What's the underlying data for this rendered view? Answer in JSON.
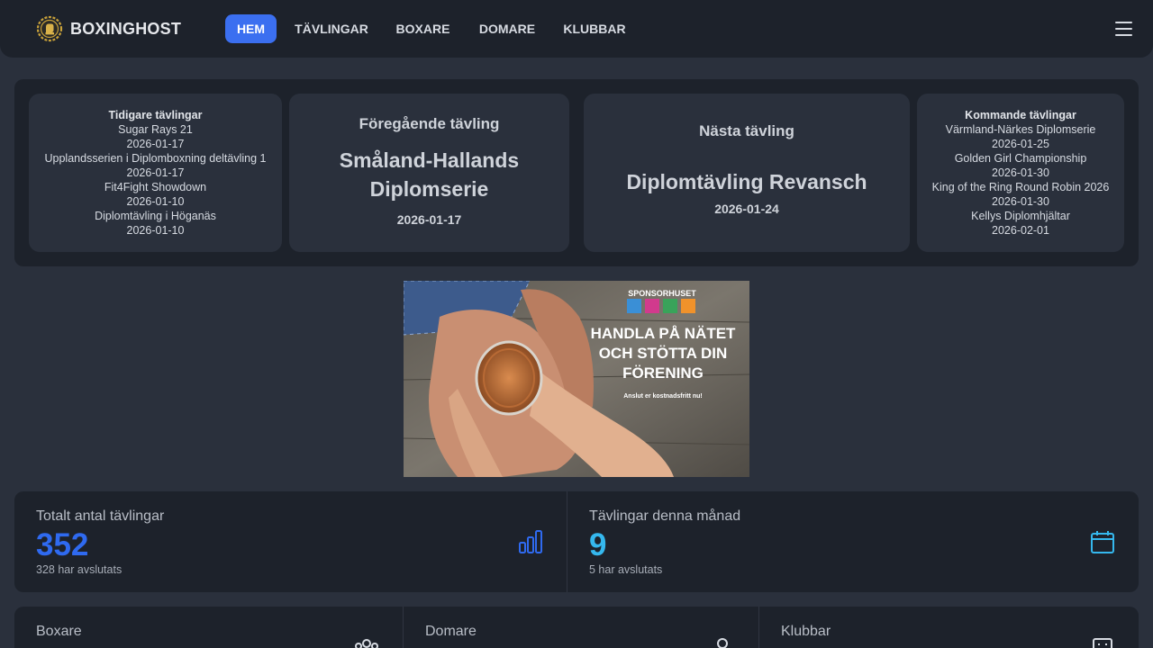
{
  "brand": {
    "name": "BOXINGHOST",
    "logo_icon": "boxing-crest-icon"
  },
  "nav": {
    "items": [
      {
        "label": "HEM",
        "active": true
      },
      {
        "label": "TÄVLINGAR",
        "active": false
      },
      {
        "label": "BOXARE",
        "active": false
      },
      {
        "label": "DOMARE",
        "active": false
      },
      {
        "label": "KLUBBAR",
        "active": false
      }
    ],
    "menu_icon": "hamburger-menu-icon"
  },
  "previous_competitions": {
    "title": "Tidigare tävlingar",
    "items": [
      {
        "name": "Sugar Rays 21",
        "date": "2026-01-17"
      },
      {
        "name": "Upplandsserien i Diplomboxning deltävling 1",
        "date": "2026-01-17"
      },
      {
        "name": "Fit4Fight Showdown",
        "date": "2026-01-10"
      },
      {
        "name": "Diplomtävling i Höganäs",
        "date": "2026-01-10"
      }
    ]
  },
  "last_competition": {
    "heading": "Föregående tävling",
    "name_line1": "Småland-Hallands",
    "name_line2": "Diplomserie",
    "date": "2026-01-17"
  },
  "next_competition": {
    "heading": "Nästa tävling",
    "name": "Diplomtävling Revansch",
    "date": "2026-01-24"
  },
  "upcoming_competitions": {
    "title": "Kommande tävlingar",
    "items": [
      {
        "name": "Värmland-Närkes Diplomserie",
        "date": "2026-01-25"
      },
      {
        "name": "Golden Girl Championship",
        "date": "2026-01-30"
      },
      {
        "name": "King of the Ring Round Robin 2026",
        "date": "2026-01-30"
      },
      {
        "name": "Kellys Diplomhjältar",
        "date": "2026-02-01"
      }
    ]
  },
  "ad": {
    "brand": "SPONSORHUSET",
    "headline1": "HANDLA PÅ NÄTET",
    "headline2": "OCH STÖTTA DIN",
    "headline3": "FÖRENING",
    "tagline": "Anslut er kostnadsfritt nu!"
  },
  "stats": {
    "total": {
      "label": "Totalt antal tävlingar",
      "value": "352",
      "sub": "328 har avslutats",
      "icon": "bar-chart-icon",
      "color": "#2f6af0"
    },
    "month": {
      "label": "Tävlingar denna månad",
      "value": "9",
      "sub": "5 har avslutats",
      "icon": "calendar-icon",
      "color": "#35b8ee"
    },
    "boxers": {
      "label": "Boxare",
      "icon": "users-icon"
    },
    "referees": {
      "label": "Domare",
      "icon": "user-icon"
    },
    "clubs": {
      "label": "Klubbar",
      "icon": "building-icon"
    }
  }
}
